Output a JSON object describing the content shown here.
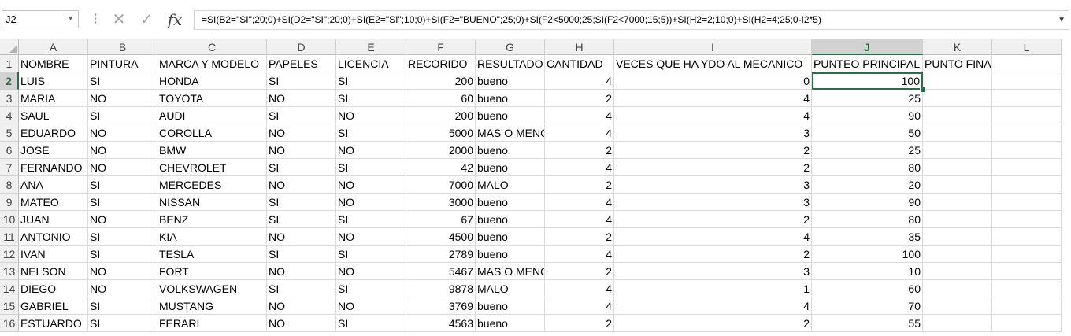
{
  "formula_bar": {
    "name_box": "J2",
    "cancel_symbol": "✕",
    "enter_symbol": "✓",
    "fx_label": "fx",
    "formula": "=SI(B2=\"SI\";20;0)+SI(D2=\"SI\";20;0)+SI(E2=\"SI\";10;0)+SI(F2=\"BUENO\";25;0)+SI(F2<5000;25;SI(F2<7000;15;5))+SI(H2=2;10;0)+SI(H2=4;25;0-I2*5)"
  },
  "selected_cell": "J2",
  "selection_color": "#217346",
  "columns": [
    "A",
    "B",
    "C",
    "D",
    "E",
    "F",
    "G",
    "H",
    "I",
    "J",
    "K",
    "L"
  ],
  "rows": [
    {
      "num": "1",
      "cells": [
        "NOMBRE",
        "PINTURA",
        "MARCA Y MODELO",
        "PAPELES",
        "LICENCIA",
        "RECORIDO",
        "RESULTADO",
        "CANTIDAD",
        "VECES QUE HA YDO AL MECANICO",
        "PUNTEO PRINCIPAL",
        "PUNTO FINAL",
        ""
      ]
    },
    {
      "num": "2",
      "cells": [
        "LUIS",
        "SI",
        "HONDA",
        "SI",
        "SI",
        "200",
        "bueno",
        "4",
        "0",
        "100",
        "",
        ""
      ]
    },
    {
      "num": "3",
      "cells": [
        "MARIA",
        "NO",
        "TOYOTA",
        "NO",
        "SI",
        "60",
        "bueno",
        "2",
        "4",
        "25",
        "",
        ""
      ]
    },
    {
      "num": "4",
      "cells": [
        "SAUL",
        "SI",
        "AUDI",
        "SI",
        "NO",
        "200",
        "bueno",
        "4",
        "4",
        "90",
        "",
        ""
      ]
    },
    {
      "num": "5",
      "cells": [
        "EDUARDO",
        "NO",
        "COROLLA",
        "NO",
        "SI",
        "5000",
        "MAS O MENOS",
        "4",
        "3",
        "50",
        "",
        ""
      ]
    },
    {
      "num": "6",
      "cells": [
        "JOSE",
        "NO",
        "BMW",
        "NO",
        "NO",
        "2000",
        "bueno",
        "2",
        "2",
        "25",
        "",
        ""
      ]
    },
    {
      "num": "7",
      "cells": [
        "FERNANDO",
        "NO",
        "CHEVROLET",
        "SI",
        "SI",
        "42",
        "bueno",
        "4",
        "2",
        "80",
        "",
        ""
      ]
    },
    {
      "num": "8",
      "cells": [
        "ANA",
        "SI",
        "MERCEDES",
        "NO",
        "NO",
        "7000",
        "MALO",
        "2",
        "3",
        "20",
        "",
        ""
      ]
    },
    {
      "num": "9",
      "cells": [
        "MATEO",
        "SI",
        "NISSAN",
        "SI",
        "NO",
        "3000",
        "bueno",
        "4",
        "3",
        "90",
        "",
        ""
      ]
    },
    {
      "num": "10",
      "cells": [
        "JUAN",
        "NO",
        "BENZ",
        "SI",
        "SI",
        "67",
        "bueno",
        "4",
        "2",
        "80",
        "",
        ""
      ]
    },
    {
      "num": "11",
      "cells": [
        "ANTONIO",
        "SI",
        "KIA",
        "NO",
        "NO",
        "4500",
        "bueno",
        "2",
        "4",
        "35",
        "",
        ""
      ]
    },
    {
      "num": "12",
      "cells": [
        "IVAN",
        "SI",
        "TESLA",
        "SI",
        "SI",
        "2789",
        "bueno",
        "4",
        "2",
        "100",
        "",
        ""
      ]
    },
    {
      "num": "13",
      "cells": [
        "NELSON",
        "NO",
        "FORT",
        "NO",
        "NO",
        "5467",
        "MAS O MENOS",
        "2",
        "3",
        "10",
        "",
        ""
      ]
    },
    {
      "num": "14",
      "cells": [
        "DIEGO",
        "NO",
        "VOLKSWAGEN",
        "SI",
        "SI",
        "9878",
        "MALO",
        "4",
        "1",
        "60",
        "",
        ""
      ]
    },
    {
      "num": "15",
      "cells": [
        "GABRIEL",
        "SI",
        "MUSTANG",
        "NO",
        "NO",
        "3769",
        "bueno",
        "4",
        "4",
        "70",
        "",
        ""
      ]
    },
    {
      "num": "16",
      "cells": [
        "ESTUARDO",
        "SI",
        "FERARI",
        "NO",
        "SI",
        "4563",
        "bueno",
        "2",
        "2",
        "55",
        "",
        ""
      ]
    }
  ]
}
